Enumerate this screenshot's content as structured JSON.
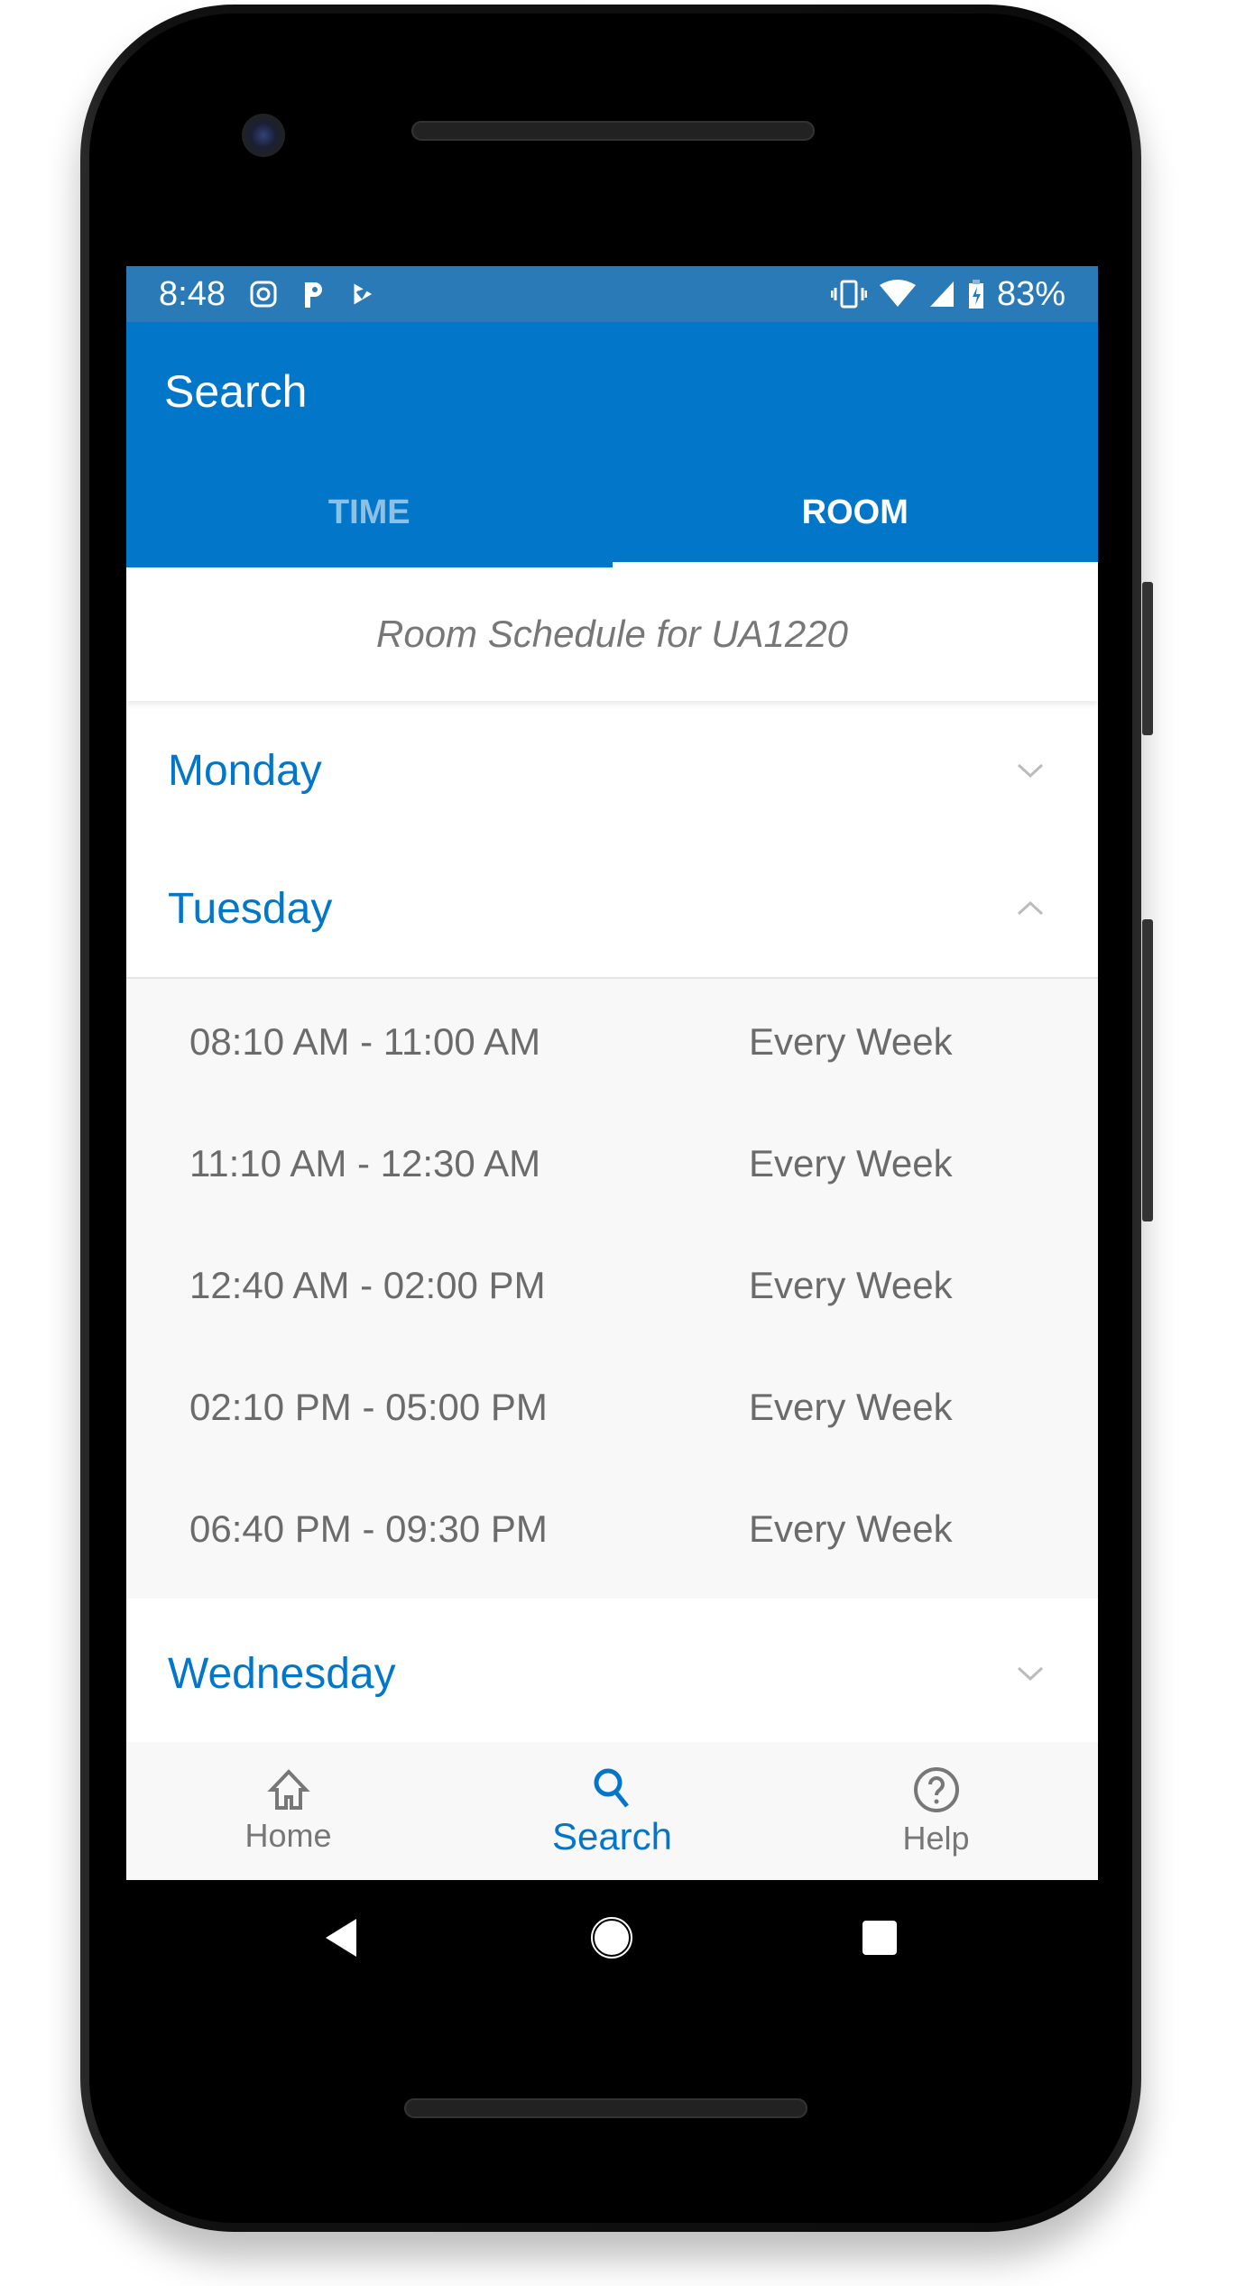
{
  "status_bar": {
    "time": "8:48",
    "battery": "83%",
    "icons": [
      "instagram-icon",
      "p-app-icon",
      "check-app-icon",
      "vibrate-icon",
      "wifi-icon",
      "signal-icon",
      "battery-charging-icon"
    ]
  },
  "app_bar": {
    "title": "Search"
  },
  "tabs": [
    {
      "label": "TIME",
      "active": false
    },
    {
      "label": "ROOM",
      "active": true
    }
  ],
  "schedule": {
    "header": "Room Schedule for UA1220",
    "days": [
      {
        "name": "Monday",
        "expanded": false
      },
      {
        "name": "Tuesday",
        "expanded": true,
        "slots": [
          {
            "time": "08:10 AM - 11:00 AM",
            "recurrence": "Every Week"
          },
          {
            "time": "11:10 AM - 12:30 AM",
            "recurrence": "Every Week"
          },
          {
            "time": "12:40 AM - 02:00 PM",
            "recurrence": "Every Week"
          },
          {
            "time": "02:10 PM - 05:00 PM",
            "recurrence": "Every Week"
          },
          {
            "time": "06:40 PM - 09:30 PM",
            "recurrence": "Every Week"
          }
        ]
      },
      {
        "name": "Wednesday",
        "expanded": false
      }
    ]
  },
  "bottom_nav": [
    {
      "label": "Home",
      "icon": "home-icon"
    },
    {
      "label": "Search",
      "icon": "search-icon",
      "active": true
    },
    {
      "label": "Help",
      "icon": "help-icon"
    }
  ],
  "colors": {
    "primary": "#0277c9",
    "status": "#2b7ab8",
    "text": "#6b6b6b"
  }
}
